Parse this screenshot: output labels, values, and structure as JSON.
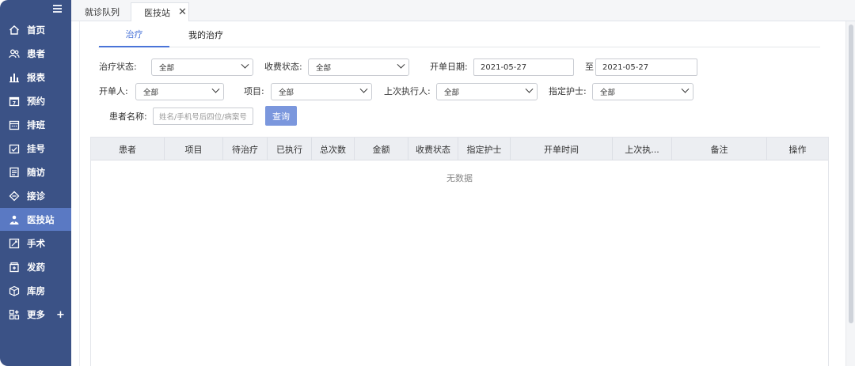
{
  "sidebar": {
    "items": [
      {
        "label": "首页",
        "icon": "home-icon"
      },
      {
        "label": "患者",
        "icon": "users-icon"
      },
      {
        "label": "报表",
        "icon": "bar-chart-icon"
      },
      {
        "label": "预约",
        "icon": "calendar-icon"
      },
      {
        "label": "排班",
        "icon": "schedule-icon"
      },
      {
        "label": "挂号",
        "icon": "register-icon"
      },
      {
        "label": "随访",
        "icon": "document-icon"
      },
      {
        "label": "接诊",
        "icon": "diamond-icon"
      },
      {
        "label": "医技站",
        "icon": "medtech-icon"
      },
      {
        "label": "手术",
        "icon": "surgery-icon"
      },
      {
        "label": "发药",
        "icon": "medicine-icon"
      },
      {
        "label": "库房",
        "icon": "box-icon"
      },
      {
        "label": "更多",
        "icon": "grid-plus-icon"
      }
    ],
    "more_plus": "+",
    "accent": "#5a79c3",
    "background": "#3b5286"
  },
  "tabs": {
    "items": [
      {
        "label": "就诊队列"
      },
      {
        "label": "医技站"
      }
    ],
    "close": "✕"
  },
  "subtabs": {
    "treatment": "治疗",
    "my_treatment": "我的治疗"
  },
  "filters": {
    "treat_status_label": "治疗状态:",
    "treat_status_value": "全部",
    "charge_status_label": "收费状态:",
    "charge_status_value": "全部",
    "order_date_label": "开单日期:",
    "date_from": "2021-05-27",
    "to_label": "至",
    "date_to": "2021-05-27",
    "orderer_label": "开单人:",
    "orderer_value": "全部",
    "item_label": "项目:",
    "item_value": "全部",
    "last_exec_label": "上次执行人:",
    "last_exec_value": "全部",
    "nurse_label": "指定护士:",
    "nurse_value": "全部",
    "patient_name_label": "患者名称:",
    "patient_placeholder": "姓名/手机号后四位/病案号",
    "query_button": "查询"
  },
  "table": {
    "columns": [
      "患者",
      "项目",
      "待治疗",
      "已执行",
      "总次数",
      "金额",
      "收费状态",
      "指定护士",
      "开单时间",
      "上次执...",
      "备注",
      "操作"
    ],
    "empty_text": "无数据"
  }
}
